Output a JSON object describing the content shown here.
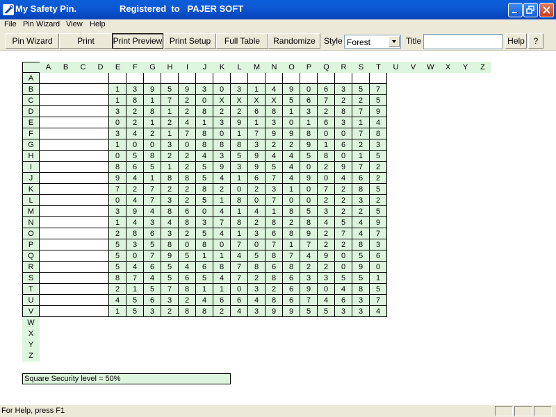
{
  "window": {
    "app_title": "My Safety Pin.",
    "registration": "Registered  to   PAJER SOFT",
    "colors": {
      "titlebar": "#0a5fd8",
      "grid_header": "#ddf5dd",
      "chrome": "#ece9d8"
    }
  },
  "menu": [
    {
      "label": "File"
    },
    {
      "label": "Pin Wizard"
    },
    {
      "label": "View"
    },
    {
      "label": "Help"
    }
  ],
  "toolbar": {
    "buttons": [
      {
        "label": "Pin Wizard",
        "pressed": false
      },
      {
        "label": "Print",
        "pressed": false
      },
      {
        "label": "Print Preview",
        "pressed": true
      },
      {
        "label": "Print Setup",
        "pressed": false
      },
      {
        "label": "Full Table",
        "pressed": false
      },
      {
        "label": "Randomize",
        "pressed": false
      }
    ],
    "style_label": "Style",
    "style_value": "Forest",
    "title_label": "Title",
    "title_value": "",
    "help_label": "Help",
    "question_label": "?"
  },
  "grid": {
    "columns": [
      "A",
      "B",
      "C",
      "D",
      "E",
      "F",
      "G",
      "H",
      "I",
      "J",
      "K",
      "L",
      "M",
      "N",
      "O",
      "P",
      "Q",
      "R",
      "S",
      "T",
      "U",
      "V",
      "W",
      "X",
      "Y",
      "Z"
    ],
    "rows": [
      {
        "label": "A",
        "values": ""
      },
      {
        "label": "B",
        "values": "1395930314906357"
      },
      {
        "label": "C",
        "values": "181720XXXX567225"
      },
      {
        "label": "D",
        "values": "3281282268132879"
      },
      {
        "label": "E",
        "values": "0212413913016314"
      },
      {
        "label": "F",
        "values": "3421780179980078"
      },
      {
        "label": "G",
        "values": "1003088832291623"
      },
      {
        "label": "H",
        "values": "0582243594458015"
      },
      {
        "label": "I",
        "values": "8651259395402972"
      },
      {
        "label": "J",
        "values": "9418854167490462"
      },
      {
        "label": "K",
        "values": "7272282023107285"
      },
      {
        "label": "L",
        "values": "0473251807002232"
      },
      {
        "label": "M",
        "values": "3948604141853225"
      },
      {
        "label": "N",
        "values": "1434837828284549"
      },
      {
        "label": "O",
        "values": "2863254136892747"
      },
      {
        "label": "P",
        "values": "5358080707172283"
      },
      {
        "label": "Q",
        "values": "5079511458749056"
      },
      {
        "label": "R",
        "values": "5465468786822090"
      },
      {
        "label": "S",
        "values": "8745654728633551"
      },
      {
        "label": "T",
        "values": "2157811032690485"
      },
      {
        "label": "U",
        "values": "4563246648674637"
      },
      {
        "label": "V",
        "values": "1532882439955334"
      },
      {
        "label": "W",
        "values": ""
      },
      {
        "label": "X",
        "values": ""
      },
      {
        "label": "Y",
        "values": ""
      },
      {
        "label": "Z",
        "values": ""
      }
    ]
  },
  "security_text": "Square Security level = 50%",
  "status": {
    "message": "For Help, press F1"
  }
}
